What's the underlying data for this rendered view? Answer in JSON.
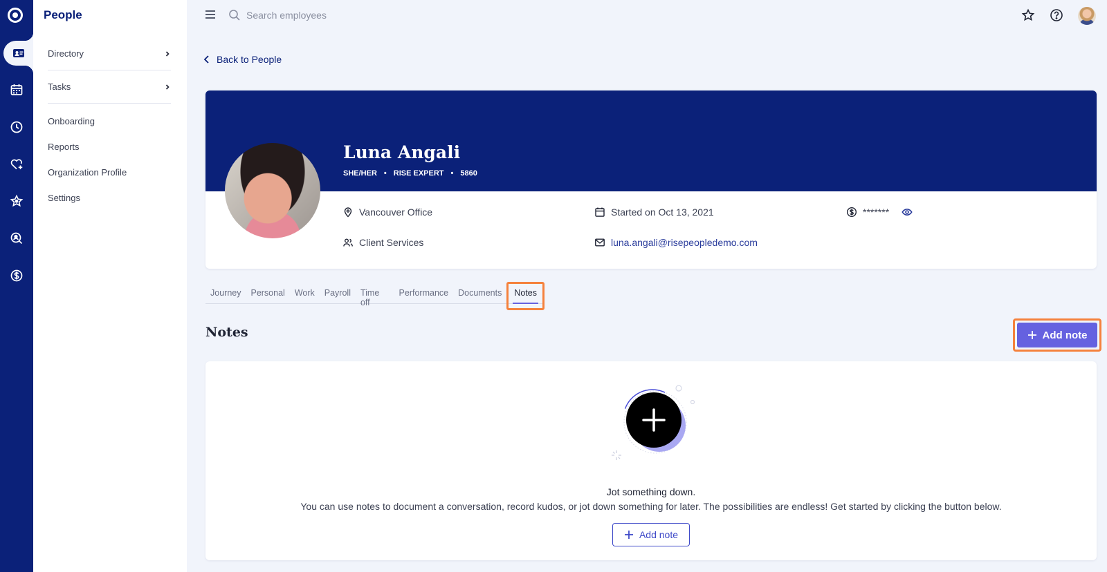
{
  "app": {
    "section_title": "People"
  },
  "sidenav": {
    "expandable": [
      {
        "label": "Directory"
      },
      {
        "label": "Tasks"
      }
    ],
    "links": [
      {
        "label": "Onboarding"
      },
      {
        "label": "Reports"
      },
      {
        "label": "Organization Profile"
      },
      {
        "label": "Settings"
      }
    ]
  },
  "topbar": {
    "search_placeholder": "Search employees"
  },
  "back_link": "Back to People",
  "profile": {
    "name": "Luna Angali",
    "pronouns": "SHE/HER",
    "role": "RISE EXPERT",
    "employee_id": "5860",
    "separator": "•",
    "location": "Vancouver Office",
    "department": "Client Services",
    "start_date": "Started on Oct 13, 2021",
    "email": "luna.angali@risepeopledemo.com",
    "salary_masked": "*******"
  },
  "tabs": [
    {
      "label": "Journey"
    },
    {
      "label": "Personal"
    },
    {
      "label": "Work"
    },
    {
      "label": "Payroll"
    },
    {
      "label": "Time off"
    },
    {
      "label": "Performance"
    },
    {
      "label": "Documents"
    },
    {
      "label": "Notes",
      "active": true
    }
  ],
  "notes": {
    "title": "Notes",
    "add_button_label": "Add note",
    "empty_title": "Jot something down.",
    "empty_description": "You can use notes to document a conversation, record kudos, or jot down something for later. The possibilities are endless! Get started by clicking the button below.",
    "empty_button_label": "Add note"
  },
  "colors": {
    "navy": "#0b2179",
    "accent": "#6561e0",
    "highlight": "#f5813c",
    "background": "#f1f4fb"
  },
  "icons": [
    "logo-icon",
    "people-icon",
    "calendar-icon",
    "clock-icon",
    "heart-plus-icon",
    "star-icon",
    "search-person-icon",
    "dollar-icon",
    "menu-icon",
    "search-icon",
    "star-outline-icon",
    "help-icon",
    "location-icon",
    "calendar-icon",
    "dollar-circle-icon",
    "eye-icon",
    "team-icon",
    "mail-icon",
    "plus-icon"
  ]
}
